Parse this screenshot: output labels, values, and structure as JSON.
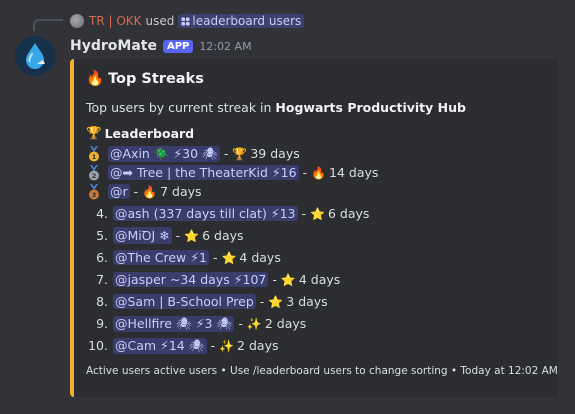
{
  "reply": {
    "user": "TR | OKK",
    "used_label": "used",
    "command": "leaderboard users",
    "command_icon": "slash-command-icon"
  },
  "message": {
    "bot_name": "HydroMate",
    "badge": "APP",
    "timestamp": "12:02 AM"
  },
  "embed": {
    "accent_color": "#f0b132",
    "title_emoji": "🔥",
    "title": "Top Streaks",
    "description_prefix": "Top users by current streak in ",
    "server_name": "Hogwarts Productivity Hub",
    "leaderboard_emoji": "🏆",
    "leaderboard_heading": "Leaderboard",
    "rows": [
      {
        "rank": "",
        "medal": "gold",
        "user": "@Axin 🪲 ⚡30 🕷",
        "emoji": "🏆",
        "days": "39 days"
      },
      {
        "rank": "",
        "medal": "silver",
        "user": "@➡ Tree | the TheaterKid ⚡16",
        "emoji": "🔥",
        "days": "14 days"
      },
      {
        "rank": "",
        "medal": "bronze",
        "user": "@r",
        "emoji": "🔥",
        "days": "7 days"
      },
      {
        "rank": "4.",
        "medal": "",
        "user": "@ash (337 days till clat) ⚡13",
        "emoji": "⭐",
        "days": "6 days"
      },
      {
        "rank": "5.",
        "medal": "",
        "user": "@MiꝹJ ❄",
        "emoji": "⭐",
        "days": "6 days"
      },
      {
        "rank": "6.",
        "medal": "",
        "user": "@The Crew ⚡1",
        "emoji": "⭐",
        "days": "4 days"
      },
      {
        "rank": "7.",
        "medal": "",
        "user": "@jasper ~34 days ⚡107",
        "emoji": "⭐",
        "days": "4 days"
      },
      {
        "rank": "8.",
        "medal": "",
        "user": "@Sam | B-School Prep",
        "emoji": "⭐",
        "days": "3 days"
      },
      {
        "rank": "9.",
        "medal": "",
        "user": "@Hellfire 🕷 ⚡3 🕷",
        "emoji": "✨",
        "days": "2 days"
      },
      {
        "rank": "10.",
        "medal": "",
        "user": "@Cam ⚡14 🕷",
        "emoji": "✨",
        "days": "2 days"
      }
    ],
    "separator": "-",
    "footer": "Active users active users • Use /leaderboard users to change sorting • Today at 12:02 AM"
  },
  "colors": {
    "background": "#313338",
    "embed_bg": "#2b2d31",
    "mention_bg": "#3c4270",
    "mention_text": "#c9cdfb",
    "gold": "#f0b132",
    "silver": "#9aa3ad",
    "bronze": "#c77a3a"
  }
}
